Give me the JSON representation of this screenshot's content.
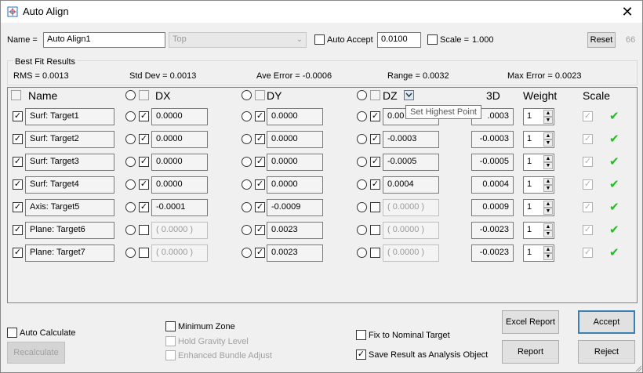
{
  "window": {
    "title": "Auto Align",
    "close_glyph": "✕"
  },
  "top": {
    "name_label": "Name =",
    "name_value": "Auto Align1",
    "combo_value": "Top",
    "auto_accept_label": "Auto Accept",
    "auto_accept_value": "0.0100",
    "scale_label": "Scale =",
    "scale_value": "1.000",
    "reset_label": "Reset",
    "count_value": "66"
  },
  "best_fit": {
    "title": "Best Fit Results",
    "rms": "RMS =   0.0013",
    "std_dev": "Std Dev =  0.0013",
    "ave_error": "Ave Error =  -0.0006",
    "range": "Range =   0.0032",
    "max_error": "Max Error =  0.0023"
  },
  "columns": {
    "name": "Name",
    "dx": "DX",
    "dy": "DY",
    "dz": "DZ",
    "d3": "3D",
    "weight": "Weight",
    "scale": "Scale"
  },
  "rows": [
    {
      "name": "Surf: Target1",
      "dx": "0.0000",
      "dy": "0.0000",
      "dz": "0.00",
      "d3": ".0003",
      "weight": "1"
    },
    {
      "name": "Surf: Target2",
      "dx": "0.0000",
      "dy": "0.0000",
      "dz": "-0.0003",
      "d3": "-0.0003",
      "weight": "1"
    },
    {
      "name": "Surf: Target3",
      "dx": "0.0000",
      "dy": "0.0000",
      "dz": "-0.0005",
      "d3": "-0.0005",
      "weight": "1"
    },
    {
      "name": "Surf: Target4",
      "dx": "0.0000",
      "dy": "0.0000",
      "dz": "0.0004",
      "d3": "0.0004",
      "weight": "1"
    },
    {
      "name": "Axis: Target5",
      "dx": "-0.0001",
      "dy": "-0.0009",
      "dz": "( 0.0000 )",
      "d3": "0.0009",
      "weight": "1"
    },
    {
      "name": "Plane: Target6",
      "dx": "( 0.0000 )",
      "dy": "0.0023",
      "dz": "( 0.0000 )",
      "d3": "-0.0023",
      "weight": "1"
    },
    {
      "name": "Plane: Target7",
      "dx": "( 0.0000 )",
      "dy": "0.0023",
      "dz": "( 0.0000 )",
      "d3": "-0.0023",
      "weight": "1"
    }
  ],
  "tooltip": "Set Highest Point",
  "bottom": {
    "auto_calculate": "Auto Calculate",
    "recalculate": "Recalculate",
    "minimum_zone": "Minimum Zone",
    "hold_gravity": "Hold Gravity Level",
    "enhanced_bundle": "Enhanced Bundle Adjust",
    "fix_nominal": "Fix to Nominal Target",
    "save_result": "Save Result as Analysis Object",
    "excel_report": "Excel Report",
    "report": "Report",
    "accept": "Accept",
    "reject": "Reject"
  },
  "colors": {
    "check": "#22bb22",
    "accent": "#3c7fb1"
  },
  "icons": {
    "check": "✔",
    "checkbox_checked": "✓",
    "spin_up": "▲",
    "spin_down": "▼"
  }
}
